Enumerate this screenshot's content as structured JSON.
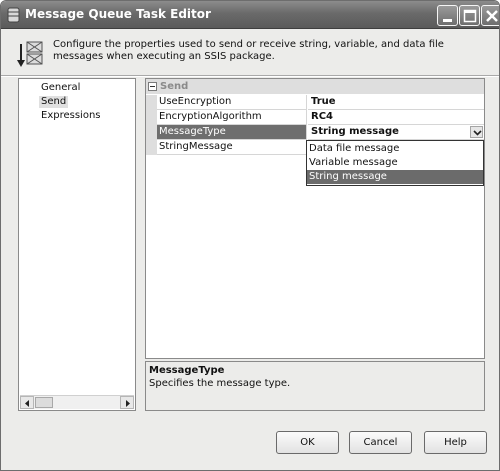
{
  "window": {
    "title": "Message Queue Task Editor"
  },
  "description": {
    "text": "Configure the properties used to send or receive string, variable, and data file messages when executing an SSIS package."
  },
  "nav": {
    "items": [
      {
        "label": "General",
        "selected": false
      },
      {
        "label": "Send",
        "selected": true
      },
      {
        "label": "Expressions",
        "selected": false
      }
    ]
  },
  "grid": {
    "category": "Send",
    "rows": [
      {
        "name": "UseEncryption",
        "value": "True"
      },
      {
        "name": "EncryptionAlgorithm",
        "value": "RC4"
      },
      {
        "name": "MessageType",
        "value": "String message"
      },
      {
        "name": "StringMessage",
        "value": ""
      }
    ],
    "dropdown_options": [
      "Data file message",
      "Variable message",
      "String message"
    ]
  },
  "help": {
    "title": "MessageType",
    "text": "Specifies the message type."
  },
  "buttons": {
    "ok": "OK",
    "cancel": "Cancel",
    "help": "Help"
  },
  "colors": {
    "selection": "#6b6b6b",
    "titlebar": "#6a6a6a"
  }
}
